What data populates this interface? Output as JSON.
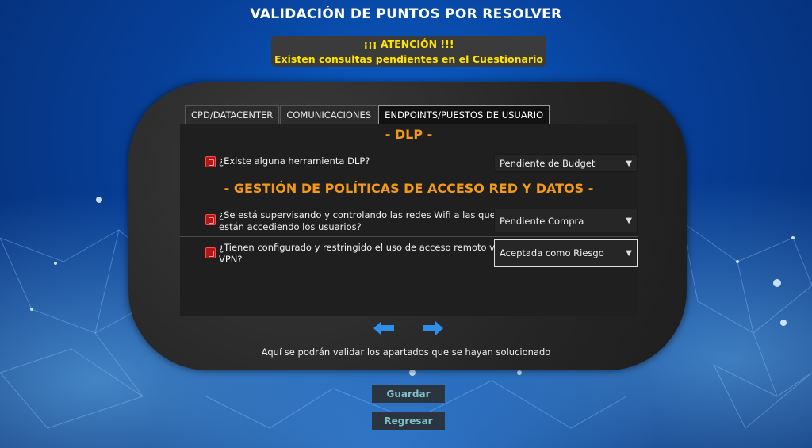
{
  "page": {
    "title": "VALIDACIÓN DE PUNTOS POR RESOLVER"
  },
  "alert": {
    "line1": "¡¡¡ ATENCIÓN !!!",
    "line2": "Existen consultas pendientes en el Cuestionario",
    "color": "#ffe400"
  },
  "tabs": [
    {
      "label": "CPD/DATACENTER",
      "active": false
    },
    {
      "label": "COMUNICACIONES",
      "active": false
    },
    {
      "label": "ENDPOINTS/PUESTOS DE USUARIO",
      "active": true
    }
  ],
  "sections": [
    {
      "title": "- DLP -",
      "questions": [
        {
          "text": "¿Existe alguna herramienta DLP?",
          "answer": "Pendiente de Budget"
        }
      ]
    },
    {
      "title": "- GESTIÓN DE POLÍTICAS DE ACCESO RED Y DATOS -",
      "questions": [
        {
          "text_line1": "¿Se está supervisando y controlando las redes Wifi a las que",
          "text_line2": "están accediendo los usuarios?",
          "answer": "Pendiente Compra"
        },
        {
          "text_line1": "¿Tienen configurado y restringido el uso de acceso remoto via",
          "text_line2": "VPN?",
          "answer": "Aceptada como Riesgo"
        }
      ]
    }
  ],
  "icons": {
    "question_status": "status-square-icon",
    "prev": "arrow-left-icon",
    "next": "arrow-right-icon",
    "select": "chevron-down-icon"
  },
  "colors": {
    "accent": "#f29a17",
    "arrows": "#2f8fe8",
    "status": "#b01717"
  },
  "info_text": "Aquí se podrán validar los apartados que se hayan solucionado",
  "buttons": {
    "save": "Guardar",
    "back": "Regresar"
  }
}
